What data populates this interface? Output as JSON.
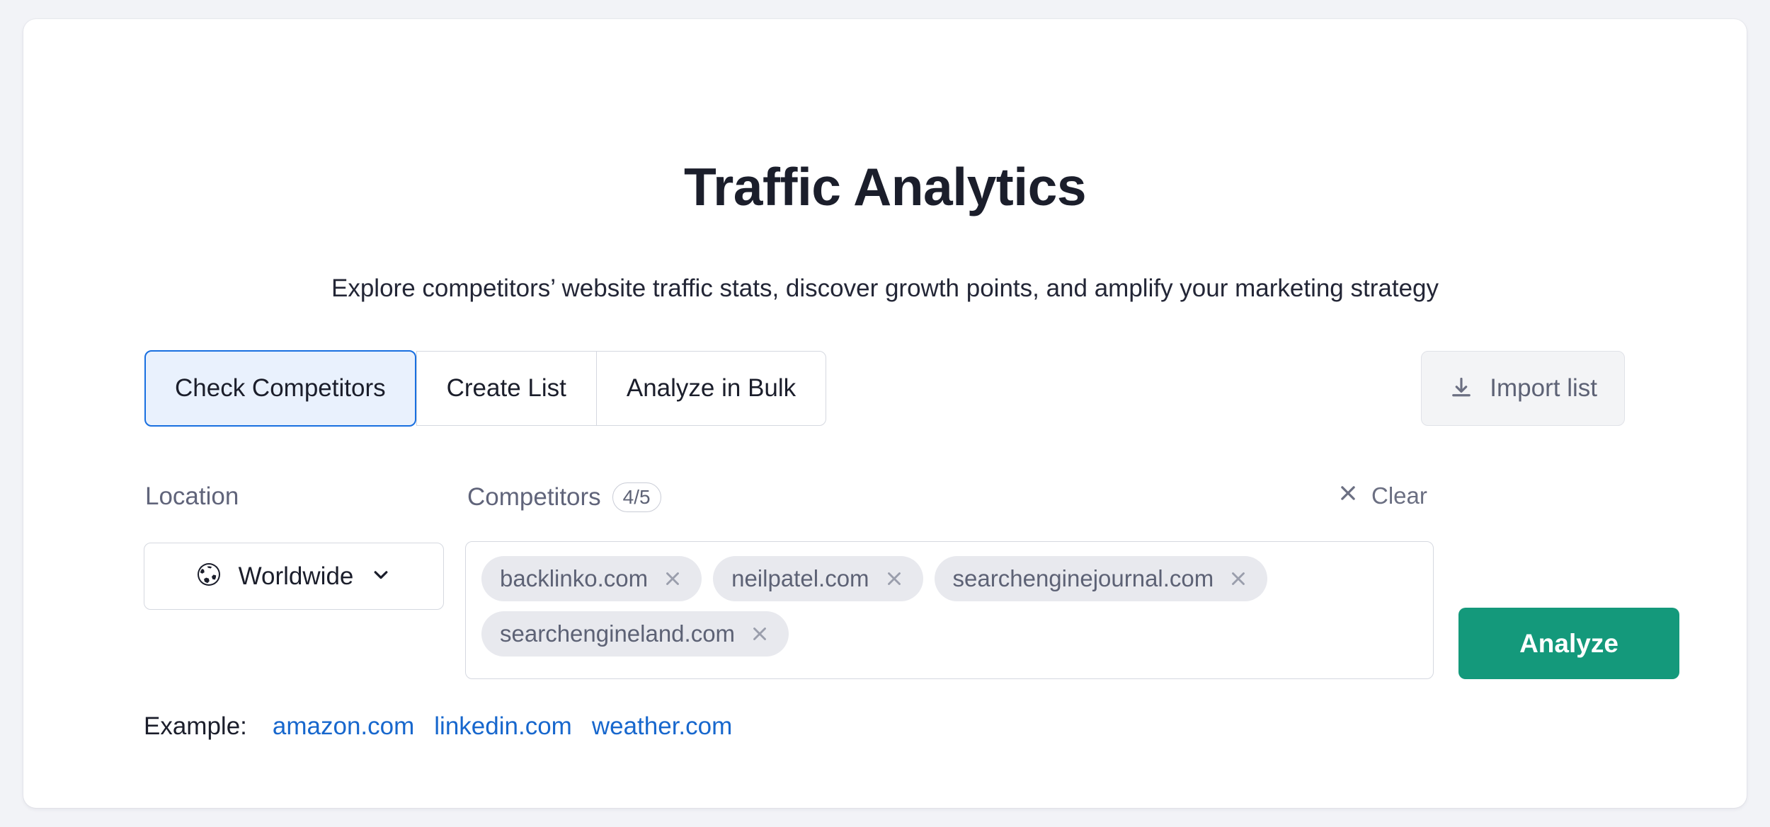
{
  "header": {
    "title": "Traffic Analytics",
    "subtitle": "Explore competitors’ website traffic stats, discover growth points, and amplify your marketing strategy"
  },
  "tabs": [
    {
      "label": "Check Competitors",
      "active": true
    },
    {
      "label": "Create List",
      "active": false
    },
    {
      "label": "Analyze in Bulk",
      "active": false
    }
  ],
  "import": {
    "label": "Import list",
    "icon": "download-tray-icon"
  },
  "location": {
    "label": "Location",
    "value": "Worldwide",
    "icon": "globe-icon",
    "chevron": "chevron-down-icon"
  },
  "competitors": {
    "label": "Competitors",
    "count_badge": "4/5",
    "clear_label": "Clear",
    "clear_icon": "close-x-icon",
    "tags": [
      {
        "domain": "backlinko.com",
        "remove_icon": "close-x-icon"
      },
      {
        "domain": "neilpatel.com",
        "remove_icon": "close-x-icon"
      },
      {
        "domain": "searchenginejournal.com",
        "remove_icon": "close-x-icon"
      },
      {
        "domain": "searchengineland.com",
        "remove_icon": "close-x-icon"
      }
    ]
  },
  "analyze": {
    "label": "Analyze"
  },
  "examples": {
    "label": "Example:",
    "links": [
      "amazon.com",
      "linkedin.com",
      "weather.com"
    ]
  },
  "colors": {
    "page_background": "#f2f3f7",
    "card_background": "#ffffff",
    "active_tab_border": "#186fe0",
    "active_tab_fill": "#e9f1fd",
    "analyze_button": "#14997b",
    "link_blue": "#1767cd",
    "tag_background": "#e8e9ee",
    "muted_text": "#60647a"
  }
}
